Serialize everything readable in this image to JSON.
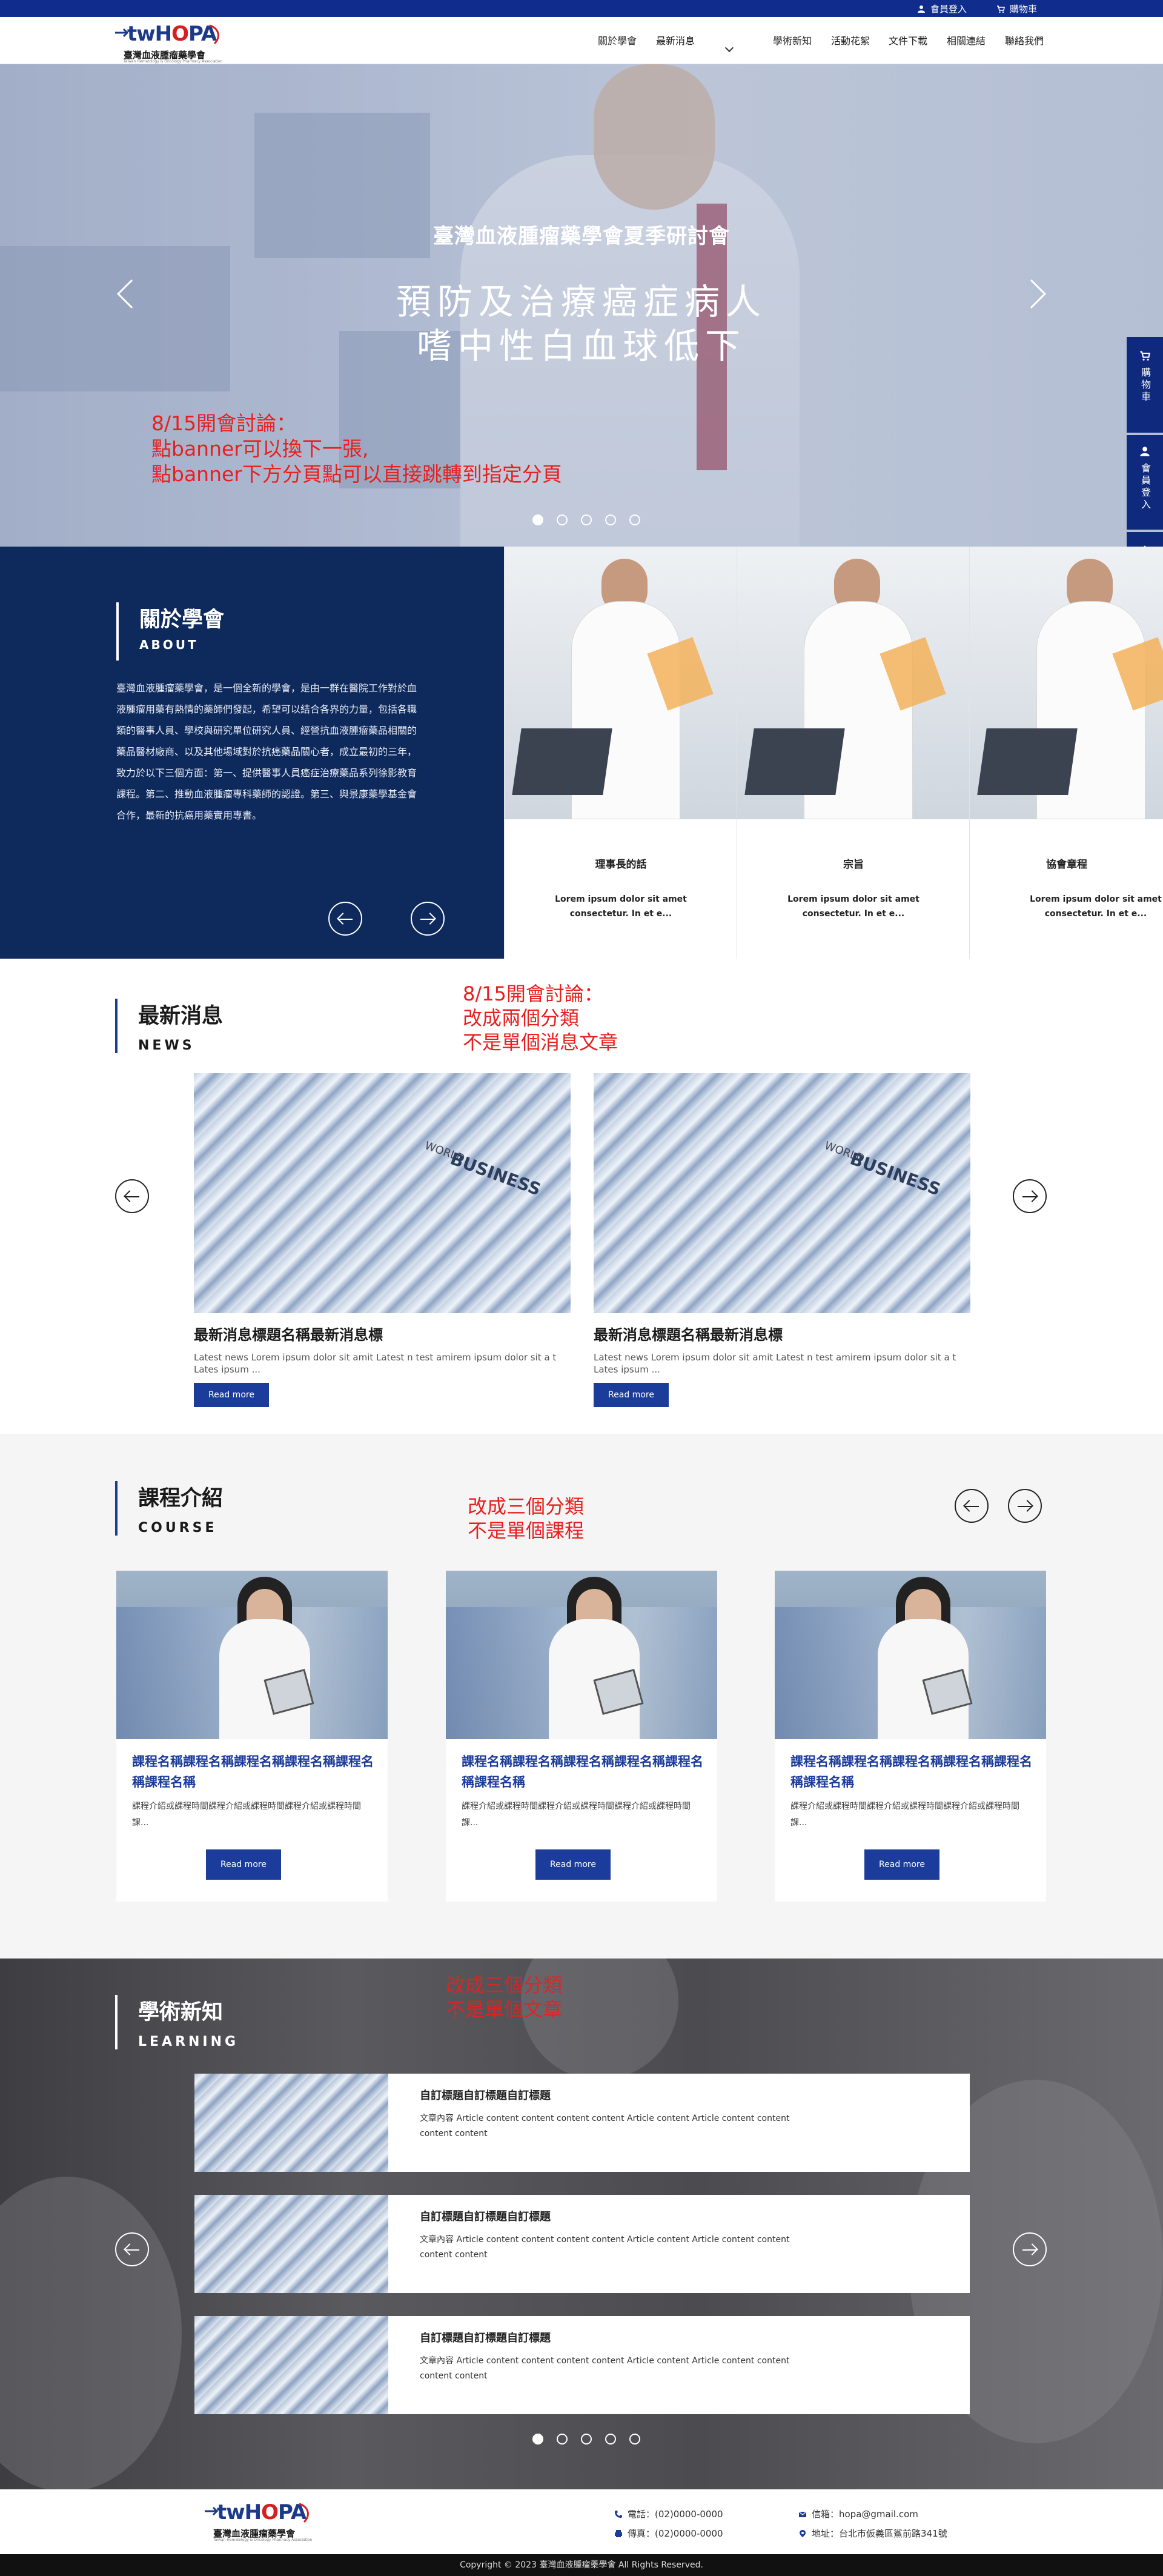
{
  "topbar": {
    "member_login": "會員登入",
    "cart": "購物車"
  },
  "logo": {
    "main_prefix": "twH",
    "main_o": "O",
    "main_suffix": "PA",
    "name": "臺灣血液腫瘤藥學會",
    "en": "Taiwan Hematology & Oncology Pharmacy Association"
  },
  "nav": [
    "關於學會",
    "最新消息",
    "學術新知",
    "活動花絮",
    "文件下載",
    "相關連結",
    "聯絡我們"
  ],
  "hero": {
    "kicker": "臺灣血液腫瘤藥學會夏季研討會",
    "title_line1": "預防及治療癌症病人",
    "title_line2": "嗜中性白血球低下",
    "note_line1": "8/15開會討論：",
    "note_line2": "點banner可以換下一張,",
    "note_line3": "點banner下方分頁點可以直接跳轉到指定分頁",
    "active_slide": 1,
    "slide_count": 5
  },
  "sidetab": {
    "cart": "購物車",
    "login": "會員登入"
  },
  "about": {
    "title": "關於學會",
    "subtitle": "ABOUT",
    "text": "臺灣血液腫瘤藥學會，是一個全新的學會，是由一群在醫院工作對於血液腫瘤用藥有熱情的藥師們發起，希望可以結合各界的力量，包括各職類的醫事人員、學校與研究單位研究人員、經營抗血液腫瘤藥品相關的藥品醫材廠商、以及其他場域對於抗癌藥品關心者，成立最初的三年，致力於以下三個方面：第一、提供醫事人員癌症治療藥品系列徐影教育課程。第二、推動血液腫瘤專科藥師的認證。第三、與景康藥學基金會合作，最新的抗癌用藥實用專書。",
    "cards": [
      {
        "title": "理事長的話",
        "desc": "Lorem ipsum dolor sit amet consectetur. In et e..."
      },
      {
        "title": "宗旨",
        "desc": "Lorem ipsum dolor sit amet consectetur. In et e..."
      },
      {
        "title": "協會章程",
        "desc": "Lorem ipsum dolor sit amet consectetur. In et e..."
      }
    ]
  },
  "news": {
    "title": "最新消息",
    "subtitle": "NEWS",
    "note_line1": "8/15開會討論：",
    "note_line2": "改成兩個分類",
    "note_line3": "不是單個消息文章",
    "img_word": "BUSINESS",
    "img_word2": "WORLD",
    "items": [
      {
        "title": "最新消息標題名稱最新消息標",
        "desc": "Latest news Lorem ipsum dolor sit amit Latest n  test amirem ipsum dolor sit a t Lates ipsum   ...",
        "button": "Read more"
      },
      {
        "title": "最新消息標題名稱最新消息標",
        "desc": "Latest news Lorem ipsum dolor sit amit Latest n  test amirem ipsum dolor sit a t Lates ipsum   ...",
        "button": "Read more"
      }
    ]
  },
  "course": {
    "title": "課程介紹",
    "subtitle": "COURSE",
    "note_line1": "改成三個分類",
    "note_line2": "不是單個課程",
    "items": [
      {
        "title": "課程名稱課程名稱課程名稱課程名稱課程名稱課程名稱",
        "desc": "課程介紹或課程時間課程介紹或課程時間課程介紹或課程時間課...",
        "button": "Read more"
      },
      {
        "title": "課程名稱課程名稱課程名稱課程名稱課程名稱課程名稱",
        "desc": "課程介紹或課程時間課程介紹或課程時間課程介紹或課程時間課...",
        "button": "Read more"
      },
      {
        "title": "課程名稱課程名稱課程名稱課程名稱課程名稱課程名稱",
        "desc": "課程介紹或課程時間課程介紹或課程時間課程介紹或課程時間課...",
        "button": "Read more"
      }
    ]
  },
  "learning": {
    "title": "學術新知",
    "subtitle": "LEARNING",
    "note_line1": "改成三個分類",
    "note_line2": "不是單個文章",
    "items": [
      {
        "title": "自訂標題自訂標題自訂標題",
        "text": "文章內容 Article content content content content Article content Article content content content content"
      },
      {
        "title": "自訂標題自訂標題自訂標題",
        "text": "文章內容 Article content content content content Article content Article content content content content"
      },
      {
        "title": "自訂標題自訂標題自訂標題",
        "text": "文章內容 Article content content content content Article content Article content content content content"
      }
    ],
    "active_slide": 1,
    "slide_count": 5
  },
  "footer": {
    "phone": "電話：(02)0000-0000",
    "fax": "傳真：(02)0000-0000",
    "email": "信箱：hopa@gmail.com",
    "address": "地址：台北市仮義區鯊前路341號",
    "copyright": "Copyright © 2023 臺灣血液腫瘤藥學會 All Rights Reserved."
  },
  "colors": {
    "primary": "#102c8c",
    "navy": "#0e2a5c",
    "accent_red": "#e82020",
    "button": "#1c3c9c"
  }
}
